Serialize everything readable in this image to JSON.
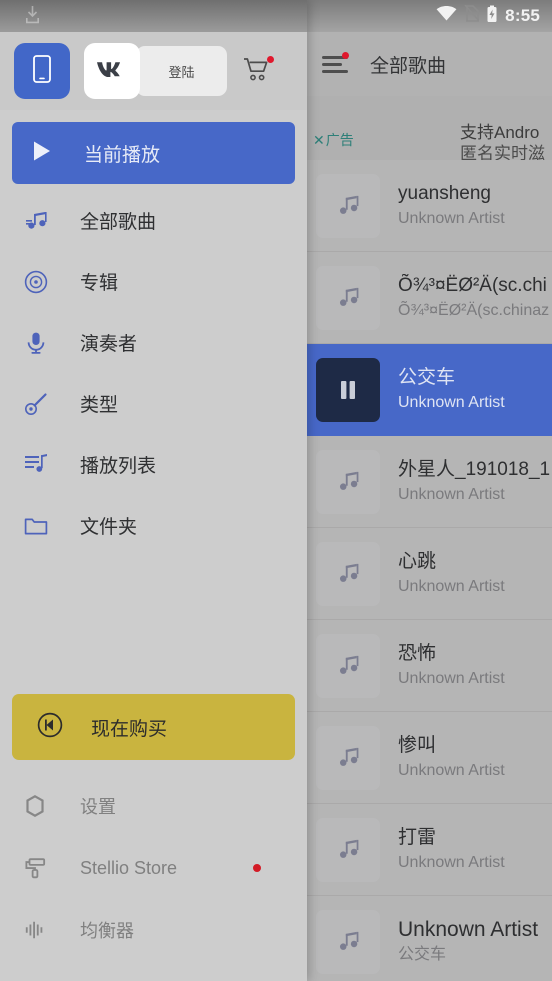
{
  "status_bar": {
    "time": "8:55",
    "icons": [
      "download-icon",
      "wifi-icon",
      "sim-off-icon",
      "battery-charging-icon"
    ]
  },
  "app_bar": {
    "menu_icon": "hamburger-menu-icon",
    "has_badge": true,
    "title": "全部歌曲"
  },
  "ad": {
    "close_label": "广告",
    "close_glyph": "✕",
    "line1": "支持Andro",
    "line2": "匿名实时滋"
  },
  "drawer": {
    "header": {
      "phone_icon": "phone-login-icon",
      "vk_icon": "vk-logo-icon",
      "tooltip": "登陆",
      "cart_icon": "shopping-cart-icon",
      "cart_has_badge": true
    },
    "now_playing": {
      "label": "当前播放",
      "icon": "play-icon"
    },
    "items": [
      {
        "label": "全部歌曲",
        "icon": "music-notes-icon"
      },
      {
        "label": "专辑",
        "icon": "album-disc-icon"
      },
      {
        "label": "演奏者",
        "icon": "microphone-icon"
      },
      {
        "label": "类型",
        "icon": "banjo-genre-icon"
      },
      {
        "label": "播放列表",
        "icon": "playlist-icon"
      },
      {
        "label": "文件夹",
        "icon": "folder-icon"
      }
    ],
    "buy": {
      "label": "现在购买",
      "icon": "stellio-logo-icon"
    },
    "footer": [
      {
        "label": "设置",
        "icon": "gear-icon",
        "badge": false
      },
      {
        "label": "Stellio Store",
        "icon": "paint-roller-icon",
        "badge": true
      },
      {
        "label": "均衡器",
        "icon": "equalizer-icon",
        "badge": false
      }
    ]
  },
  "songs": [
    {
      "title": "yuansheng",
      "artist": "Unknown Artist",
      "selected": false,
      "big": false
    },
    {
      "title": "Õ¾³¤ËØ²Ä(sc.chi",
      "artist": "Õ¾³¤ËØ²Ä(sc.chinaz",
      "selected": false,
      "big": false
    },
    {
      "title": "公交车",
      "artist": "Unknown Artist",
      "selected": true,
      "big": false
    },
    {
      "title": "外星人_191018_1",
      "artist": "Unknown Artist",
      "selected": false,
      "big": false
    },
    {
      "title": "心跳",
      "artist": "Unknown Artist",
      "selected": false,
      "big": false
    },
    {
      "title": "恐怖",
      "artist": "Unknown Artist",
      "selected": false,
      "big": false
    },
    {
      "title": "惨叫",
      "artist": "Unknown Artist",
      "selected": false,
      "big": false
    },
    {
      "title": "打雷",
      "artist": "Unknown Artist",
      "selected": false,
      "big": false
    },
    {
      "title": "Unknown Artist",
      "artist": "公交车",
      "selected": false,
      "big": true
    }
  ],
  "colors": {
    "accent_blue": "#4768c8",
    "buy_yellow": "#c9b43f",
    "badge_red": "#e0182d",
    "selected_thumb": "#1e2a46",
    "drawer_bg": "#cdcdcd",
    "content_bg": "#b5b5b5",
    "ad_teal": "#2d7f78"
  }
}
